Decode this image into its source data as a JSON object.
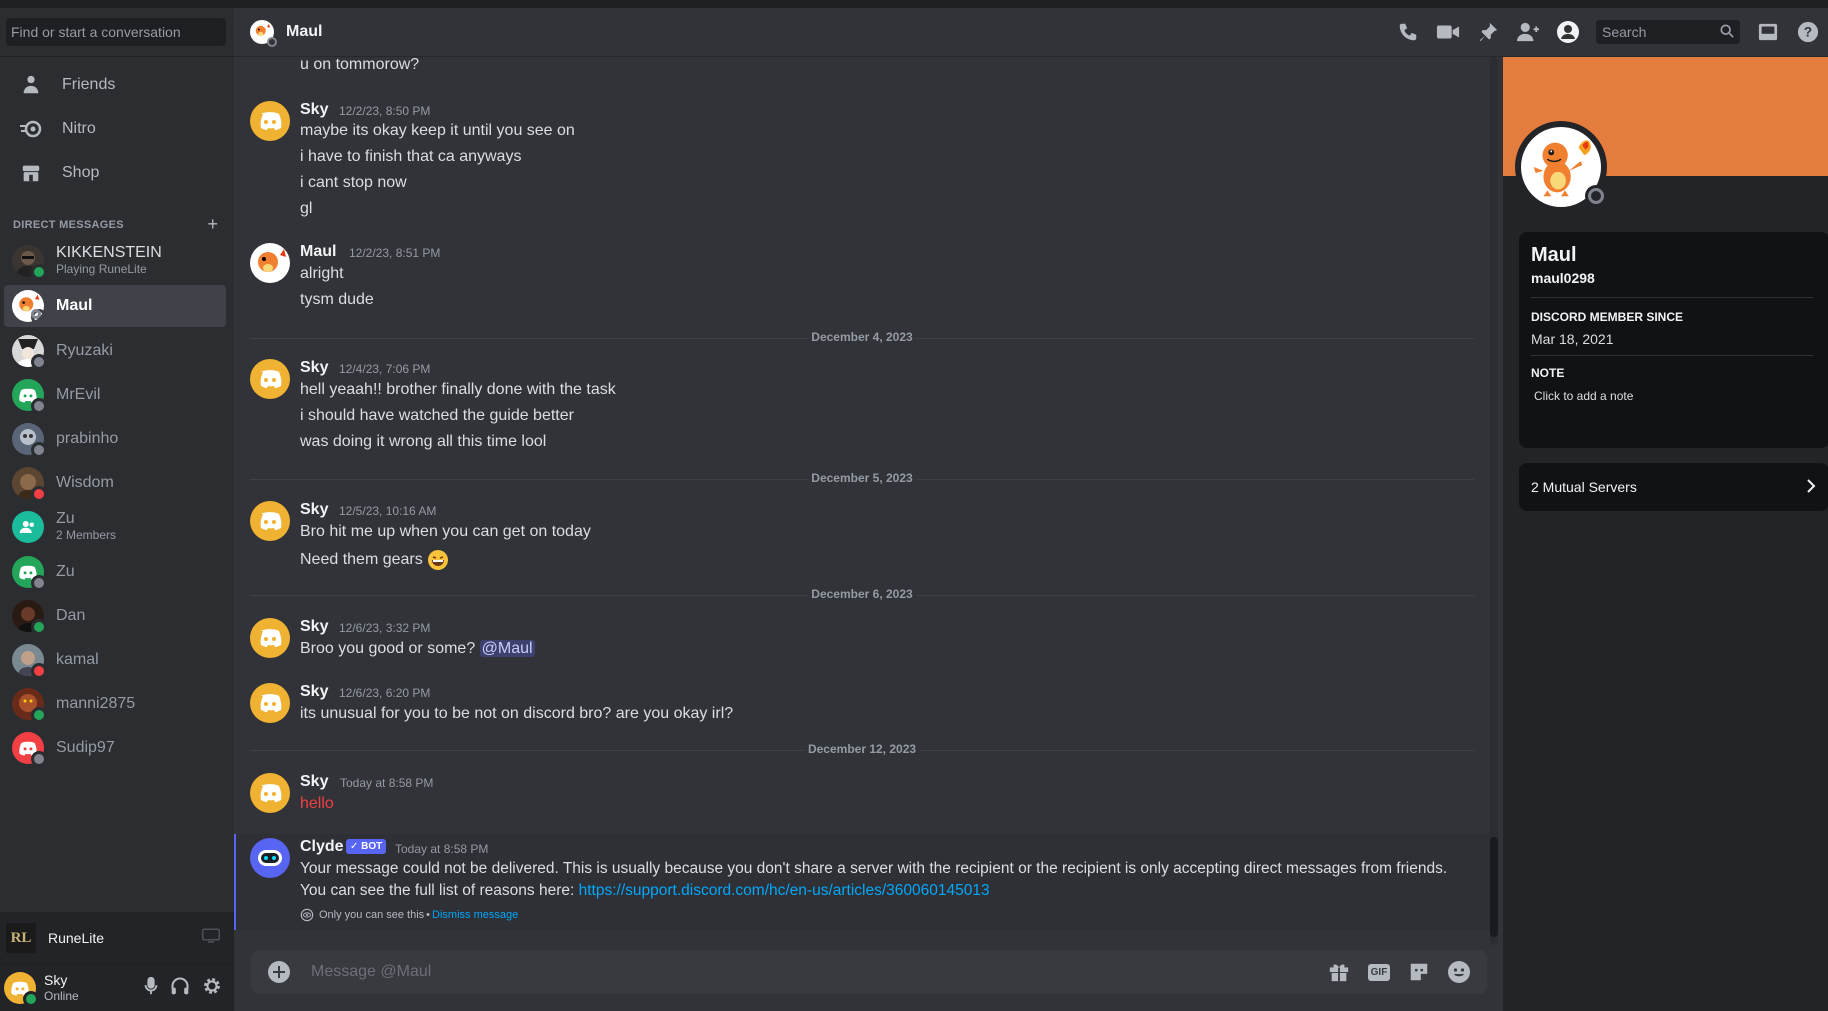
{
  "window": {
    "corner_label": "—"
  },
  "sidebar": {
    "search_placeholder": "Find or start a conversation",
    "nav": [
      {
        "label": "Friends",
        "icon": "friends-icon"
      },
      {
        "label": "Nitro",
        "icon": "nitro-icon"
      },
      {
        "label": "Shop",
        "icon": "shop-icon"
      }
    ],
    "dm_header": "DIRECT MESSAGES",
    "dm_add": "+",
    "dms": [
      {
        "name": "KIKKENSTEIN",
        "sub": "Playing RuneLite",
        "status": "online"
      },
      {
        "name": "Maul",
        "sub": "",
        "status": "offline",
        "active": true
      },
      {
        "name": "Ryuzaki",
        "sub": "",
        "status": "offline"
      },
      {
        "name": "MrEvil",
        "sub": "",
        "status": "offline"
      },
      {
        "name": "prabinho",
        "sub": "",
        "status": "offline"
      },
      {
        "name": "Wisdom",
        "sub": "",
        "status": "dnd"
      },
      {
        "name": "Zu",
        "sub": "2 Members",
        "status": "group"
      },
      {
        "name": "Zu",
        "sub": "",
        "status": "offline"
      },
      {
        "name": "Dan",
        "sub": "",
        "status": "online"
      },
      {
        "name": "kamal",
        "sub": "",
        "status": "dnd"
      },
      {
        "name": "manni2875",
        "sub": "",
        "status": "online"
      },
      {
        "name": "Sudip97",
        "sub": "",
        "status": "offline"
      }
    ],
    "app_bar": {
      "name": "RuneLite",
      "logo_text": "RL"
    },
    "user": {
      "name": "Sky",
      "status": "Online"
    }
  },
  "header": {
    "title": "Maul",
    "search_placeholder": "Search",
    "icons": [
      "call-icon",
      "video-icon",
      "pin-icon",
      "add-friend-icon",
      "profile-toggle-icon",
      "inbox-icon",
      "help-icon"
    ]
  },
  "chat": {
    "top_line": "u on tommorow?",
    "dividers": [
      "December 4, 2023",
      "December 5, 2023",
      "December 6, 2023",
      "December 12, 2023"
    ],
    "messages": [
      {
        "author": "Sky",
        "time": "12/2/23, 8:50 PM",
        "lines": [
          "maybe its okay keep it until you see on",
          "i have to finish that ca anyways",
          "i cant stop now",
          "gl"
        ]
      },
      {
        "author": "Maul",
        "time": "12/2/23, 8:51 PM",
        "lines": [
          "alright",
          "tysm dude"
        ]
      },
      {
        "author": "Sky",
        "time": "12/4/23, 7:06 PM",
        "lines": [
          "hell yeaah!! brother finally done with the task",
          "i should have watched the guide better",
          "was doing it wrong all this time lool"
        ]
      },
      {
        "author": "Sky",
        "time": "12/5/23, 10:16 AM",
        "lines": [
          "Bro hit me up when you can get on today",
          "Need them gears"
        ]
      },
      {
        "author": "Sky",
        "time": "12/6/23, 3:32 PM",
        "lines": [
          "Broo you good or some?"
        ],
        "mention": "@Maul"
      },
      {
        "author": "Sky",
        "time": "12/6/23, 6:20 PM",
        "lines": [
          "its unusual for you to be not on discord bro? are you okay irl?"
        ]
      },
      {
        "author": "Sky",
        "time": "Today at 8:58 PM",
        "lines": [
          "hello"
        ]
      }
    ],
    "clyde": {
      "author": "Clyde",
      "tag": "BOT",
      "time": "Today at 8:58 PM",
      "line1": "Your message could not be delivered. This is usually because you don't share a server with the recipient or the recipient is only accepting direct messages from friends.",
      "line2_prefix": "You can see the full list of reasons here: ",
      "link": "https://support.discord.com/hc/en-us/articles/360060145013",
      "note": "Only you can see this",
      "dismiss": "Dismiss message"
    }
  },
  "composer": {
    "placeholder": "Message @Maul",
    "gif_label": "GIF"
  },
  "profile": {
    "display_name": "Maul",
    "username": "maul0298",
    "member_since_label": "DISCORD MEMBER SINCE",
    "member_since": "Mar 18, 2021",
    "note_label": "NOTE",
    "note_placeholder": "Click to add a note",
    "mutual_servers": "2 Mutual Servers",
    "banner_color": "#e37c3c"
  },
  "colors": {
    "accent": "#5865f2",
    "online": "#23a55a",
    "dnd": "#f23f43",
    "offline": "#80848e",
    "link": "#00a8fc",
    "error": "#f23f43",
    "sky_avatar": "#f0b232"
  }
}
